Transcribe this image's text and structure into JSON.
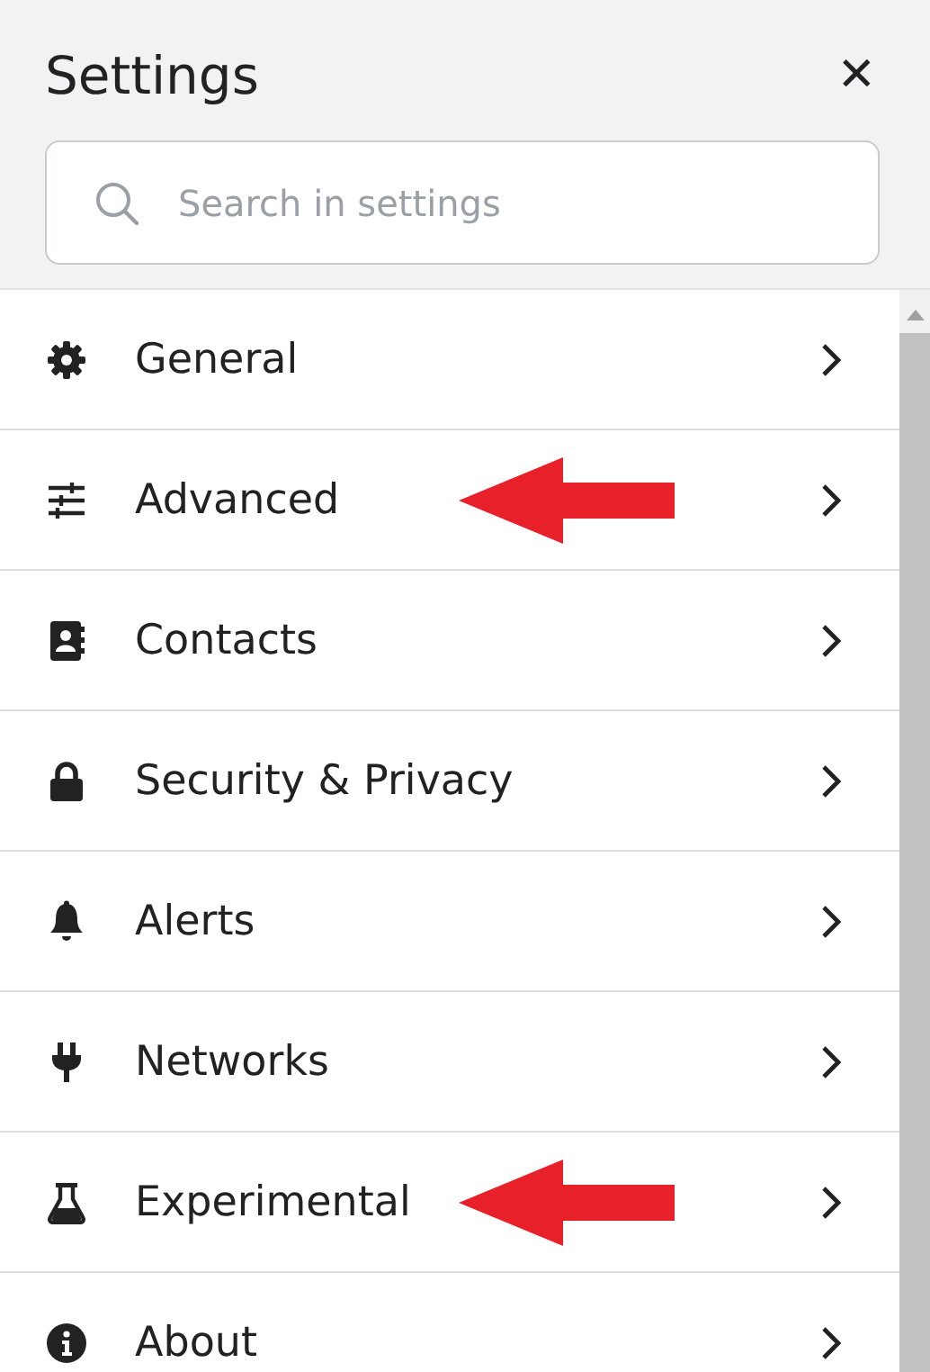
{
  "header": {
    "title": "Settings",
    "close": "✕"
  },
  "search": {
    "placeholder": "Search in settings"
  },
  "items": [
    {
      "label": "General",
      "annotated": false
    },
    {
      "label": "Advanced",
      "annotated": true
    },
    {
      "label": "Contacts",
      "annotated": false
    },
    {
      "label": "Security & Privacy",
      "annotated": false
    },
    {
      "label": "Alerts",
      "annotated": false
    },
    {
      "label": "Networks",
      "annotated": false
    },
    {
      "label": "Experimental",
      "annotated": true
    },
    {
      "label": "About",
      "annotated": false
    }
  ]
}
